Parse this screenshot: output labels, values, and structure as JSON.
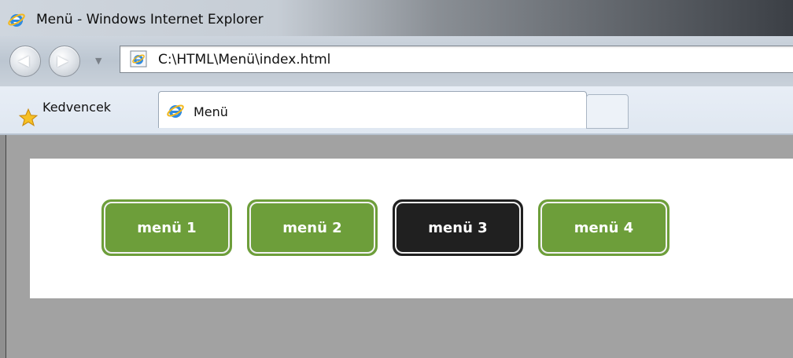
{
  "window": {
    "title": "Menü - Windows Internet Explorer"
  },
  "navigation": {
    "address": "C:\\HTML\\Menü\\index.html"
  },
  "tabbar": {
    "favorites_label": "Kedvencek",
    "tabs": [
      {
        "label": "Menü",
        "active": true
      }
    ]
  },
  "page": {
    "menu_items": [
      {
        "label": "menü 1",
        "active": false
      },
      {
        "label": "menü 2",
        "active": false
      },
      {
        "label": "menü 3",
        "active": true
      },
      {
        "label": "menü 4",
        "active": false
      }
    ]
  },
  "colors": {
    "menu_normal": "#6d9e3a",
    "menu_active": "#202020",
    "page_background": "#a2a2a2",
    "panel_background": "#ffffff"
  }
}
